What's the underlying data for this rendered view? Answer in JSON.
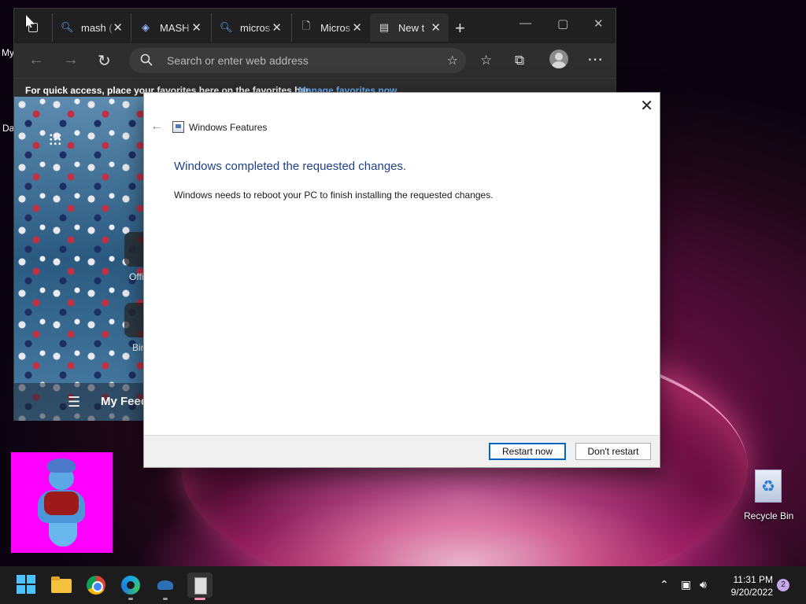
{
  "browser": {
    "tabs": [
      {
        "label": "mash (",
        "icon": "search-icon"
      },
      {
        "label": "MASH",
        "icon": "mash-logo-icon"
      },
      {
        "label": "micros",
        "icon": "search-icon"
      },
      {
        "label": "Micros",
        "icon": "document-icon"
      },
      {
        "label": "New t",
        "icon": "newtab-page-icon",
        "active": true
      }
    ],
    "address_placeholder": "Search or enter web address",
    "favorites_message": "For quick access, place your favorites here on the favorites bar.",
    "favorites_link": "Manage favorites now",
    "quicklinks": [
      "Offi",
      "Bin"
    ],
    "feed_title": "My Feed"
  },
  "dialog": {
    "window_title": "Windows Features",
    "heading": "Windows completed the requested changes.",
    "body": "Windows needs to reboot your PC to finish installing the requested changes.",
    "primary_button": "Restart now",
    "secondary_button": "Don't restart"
  },
  "desktop": {
    "left_fragments": [
      "My",
      "Da"
    ],
    "recycle_bin_label": "Recycle Bin"
  },
  "taskbar": {
    "apps": [
      "start-icon",
      "file-explorer-icon",
      "chrome-icon",
      "edge-icon",
      "network-app-icon",
      "windows-features-icon"
    ],
    "time": "11:31 PM",
    "date": "9/20/2022",
    "notification_count": "2"
  },
  "colors": {
    "dialog_heading": "#1e3f8a",
    "link": "#6cb4ff",
    "accent": "#0067c0"
  }
}
